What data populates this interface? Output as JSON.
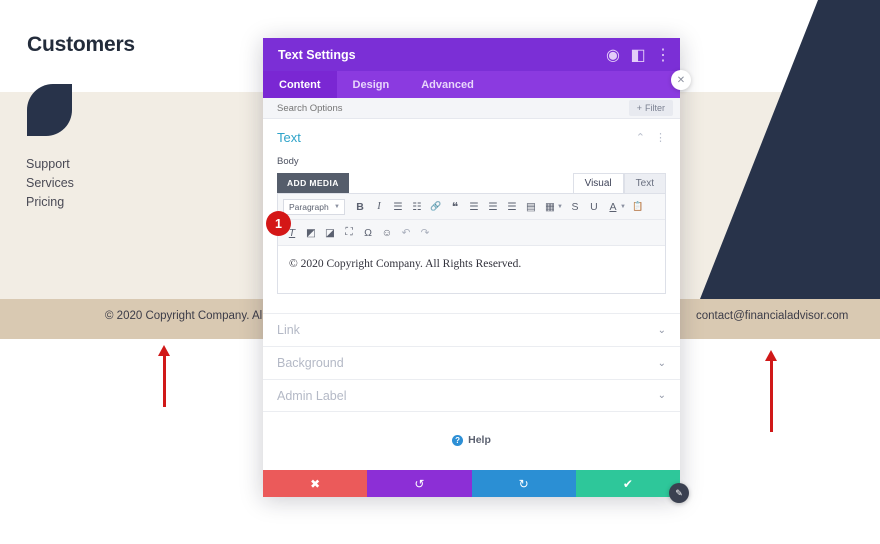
{
  "page": {
    "title": "Customers",
    "logo_icon": "brand-leaf-logo",
    "nav_items": [
      {
        "label": "Support"
      },
      {
        "label": "Services"
      },
      {
        "label": "Pricing"
      }
    ],
    "footer": {
      "copyright": "© 2020 Copyright Company. All Rights Reserved.",
      "email": "contact@financialadvisor.com"
    },
    "colors": {
      "band_white": "#ffffff",
      "band_cream": "#f2ede4",
      "band_tan": "#d9c9b2",
      "dark_navy": "#28334a",
      "annotation_red": "#d01818"
    }
  },
  "annotations": {
    "step_badge": "1",
    "arrow_left_icon": "arrow-up-icon",
    "arrow_right_icon": "arrow-up-icon"
  },
  "modal": {
    "title": "Text Settings",
    "header_icons": [
      {
        "name": "target-icon",
        "glyph": "◉"
      },
      {
        "name": "layout-split-icon",
        "glyph": "◧"
      },
      {
        "name": "kebab-menu-icon",
        "glyph": "⋮"
      }
    ],
    "tabs": [
      {
        "label": "Content",
        "active": true
      },
      {
        "label": "Design",
        "active": false
      },
      {
        "label": "Advanced",
        "active": false
      }
    ],
    "search": {
      "placeholder": "Search Options",
      "value": "",
      "filter_label": "Filter",
      "filter_icon": "plus-icon"
    },
    "section": {
      "title": "Text",
      "collapse_icon": "chevron-up-icon",
      "menu_icon": "kebab-menu-icon",
      "field_label": "Body",
      "add_media_label": "ADD MEDIA",
      "editor_tabs": [
        {
          "label": "Visual",
          "active": true
        },
        {
          "label": "Text",
          "active": false
        }
      ],
      "toolbar_row1": [
        {
          "name": "paragraph-format-select",
          "label": "Paragraph",
          "type": "select"
        },
        {
          "name": "bold-icon",
          "glyph": "B",
          "style": "bold"
        },
        {
          "name": "italic-icon",
          "glyph": "I",
          "style": "italic"
        },
        {
          "name": "bulleted-list-icon",
          "glyph": "☰"
        },
        {
          "name": "numbered-list-icon",
          "glyph": "☷"
        },
        {
          "name": "link-icon",
          "glyph": "🔗"
        },
        {
          "name": "blockquote-icon",
          "glyph": "❝"
        },
        {
          "name": "align-left-icon",
          "glyph": "☰"
        },
        {
          "name": "align-center-icon",
          "glyph": "☰"
        },
        {
          "name": "align-right-icon",
          "glyph": "☰"
        },
        {
          "name": "align-justify-icon",
          "glyph": "▤"
        },
        {
          "name": "table-icon",
          "glyph": "▦",
          "caret": true
        },
        {
          "name": "strikethrough-icon",
          "glyph": "S"
        },
        {
          "name": "underline-icon",
          "glyph": "U"
        },
        {
          "name": "text-color-icon",
          "glyph": "A",
          "caret": true
        },
        {
          "name": "paste-as-text-icon",
          "glyph": "📋"
        }
      ],
      "toolbar_row2": [
        {
          "name": "clear-formatting-icon",
          "glyph": "T"
        },
        {
          "name": "outdent-icon",
          "glyph": "◩"
        },
        {
          "name": "indent-icon",
          "glyph": "◪"
        },
        {
          "name": "fullscreen-icon",
          "glyph": "⛶"
        },
        {
          "name": "special-character-icon",
          "glyph": "Ω"
        },
        {
          "name": "emoji-icon",
          "glyph": "☺"
        },
        {
          "name": "undo-icon",
          "glyph": "↶"
        },
        {
          "name": "redo-icon",
          "glyph": "↷"
        }
      ],
      "editor_content": "© 2020 Copyright Company. All Rights Reserved."
    },
    "accordion": [
      {
        "label": "Link",
        "chevron": "chevron-down-icon"
      },
      {
        "label": "Background",
        "chevron": "chevron-down-icon"
      },
      {
        "label": "Admin Label",
        "chevron": "chevron-down-icon"
      }
    ],
    "help": {
      "label": "Help",
      "icon": "question-mark-icon",
      "glyph": "?"
    },
    "actions": [
      {
        "name": "cancel-button",
        "glyph": "✖",
        "color": "#eb5a5a"
      },
      {
        "name": "undo-button",
        "glyph": "↺",
        "color": "#8c2fd6"
      },
      {
        "name": "redo-button",
        "glyph": "↻",
        "color": "#2b8fd4"
      },
      {
        "name": "save-button",
        "glyph": "✔",
        "color": "#2ec79a"
      }
    ],
    "close_icon": "close-circle-icon",
    "close_glyph": "✕",
    "resize_icon": "resize-handle-icon",
    "resize_glyph": "✎"
  }
}
